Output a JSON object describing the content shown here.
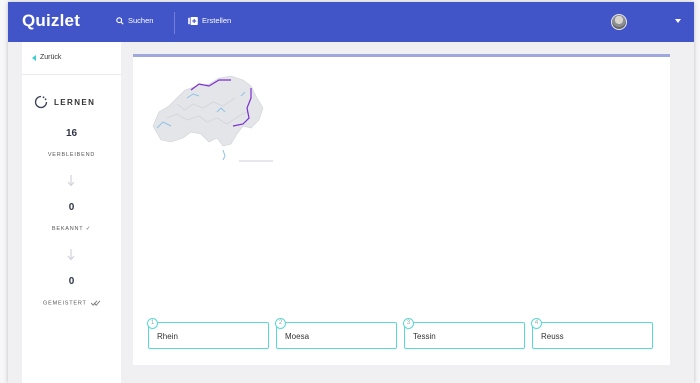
{
  "header": {
    "logo": "Quizlet",
    "search_label": "Suchen",
    "create_label": "Erstellen",
    "brand_color": "#4255c8"
  },
  "sidebar": {
    "back_label": "Zurück",
    "mode_label": "LERNEN",
    "remaining": {
      "value": "16",
      "label": "VERBLEIBEND"
    },
    "known": {
      "value": "0",
      "label": "BEKANNT ✓"
    },
    "mastered": {
      "value": "0",
      "label": "GEMEISTERT"
    }
  },
  "question": {
    "image_icon": "switzerland-map-icon",
    "progress_fraction": 1.0
  },
  "choices": [
    {
      "num": "1",
      "label": "Rhein"
    },
    {
      "num": "2",
      "label": "Moesa"
    },
    {
      "num": "3",
      "label": "Tessin"
    },
    {
      "num": "4",
      "label": "Reuss"
    }
  ],
  "colors": {
    "accent": "#5ad8d6",
    "progress": "#9ea8dc",
    "highlight_river": "#7b2fd0"
  }
}
